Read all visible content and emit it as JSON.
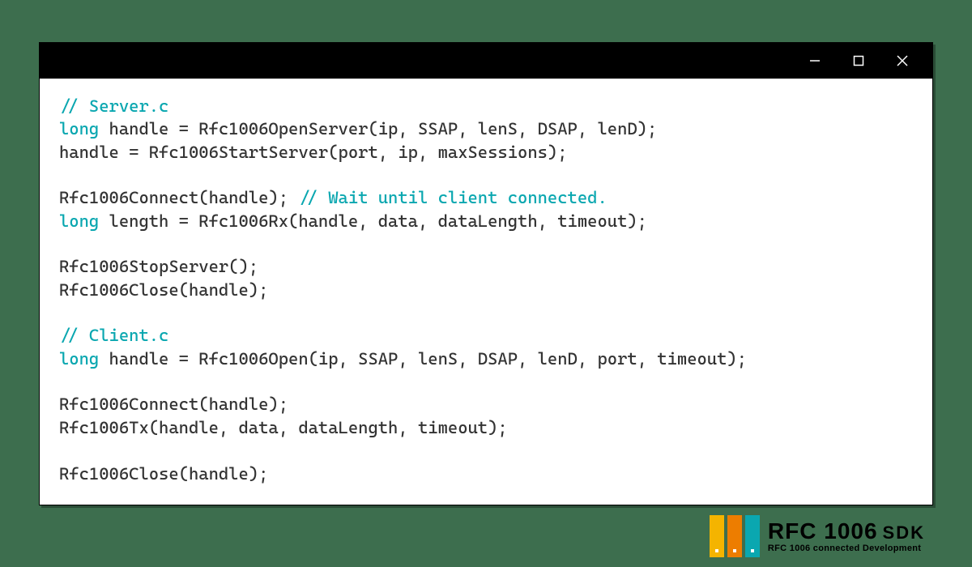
{
  "code": {
    "l1_comment": "// Server.c",
    "l2_kw": "long",
    "l2_rest": " handle = Rfc1006OpenServer(ip, SSAP, lenS, DSAP, lenD);",
    "l3": "handle = Rfc1006StartServer(port, ip, maxSessions);",
    "l4": "",
    "l5_a": "Rfc1006Connect(handle); ",
    "l5_comment": "// Wait until client connected.",
    "l6_kw": "long",
    "l6_rest": " length = Rfc1006Rx(handle, data, dataLength, timeout);",
    "l7": "",
    "l8": "Rfc1006StopServer();",
    "l9": "Rfc1006Close(handle);",
    "l10": "",
    "l11_comment": "// Client.c",
    "l12_kw": "long",
    "l12_rest": " handle = Rfc1006Open(ip, SSAP, lenS, DSAP, lenD, port, timeout);",
    "l13": "",
    "l14": "Rfc1006Connect(handle);",
    "l15": "Rfc1006Tx(handle, data, dataLength, timeout);",
    "l16": "",
    "l17": "Rfc1006Close(handle);"
  },
  "logo": {
    "title_main": "RFC 1006",
    "title_sdk": "SDK",
    "subtitle": "RFC 1006 connected Development"
  }
}
